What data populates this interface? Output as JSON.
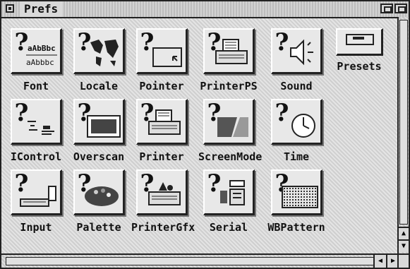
{
  "window": {
    "title": "Prefs"
  },
  "icons": [
    {
      "label": "Font",
      "glyph": "font-icon"
    },
    {
      "label": "Locale",
      "glyph": "world-map-icon"
    },
    {
      "label": "Pointer",
      "glyph": "pointer-icon"
    },
    {
      "label": "PrinterPS",
      "glyph": "postscript-printer-icon"
    },
    {
      "label": "Sound",
      "glyph": "speaker-icon"
    },
    {
      "label": "IControl",
      "glyph": "icontrol-icon"
    },
    {
      "label": "Overscan",
      "glyph": "overscan-icon"
    },
    {
      "label": "Printer",
      "glyph": "printer-icon"
    },
    {
      "label": "ScreenMode",
      "glyph": "screenmode-icon"
    },
    {
      "label": "Time",
      "glyph": "clock-icon"
    },
    {
      "label": "Input",
      "glyph": "keyboard-icon"
    },
    {
      "label": "Palette",
      "glyph": "palette-icon"
    },
    {
      "label": "PrinterGfx",
      "glyph": "printer-graphics-icon"
    },
    {
      "label": "Serial",
      "glyph": "serial-port-icon"
    },
    {
      "label": "WBPattern",
      "glyph": "pattern-icon"
    }
  ],
  "presets": {
    "label": "Presets"
  },
  "font_icon_sample": {
    "line1": "aAbBbc",
    "line2": "aAbbbc"
  }
}
